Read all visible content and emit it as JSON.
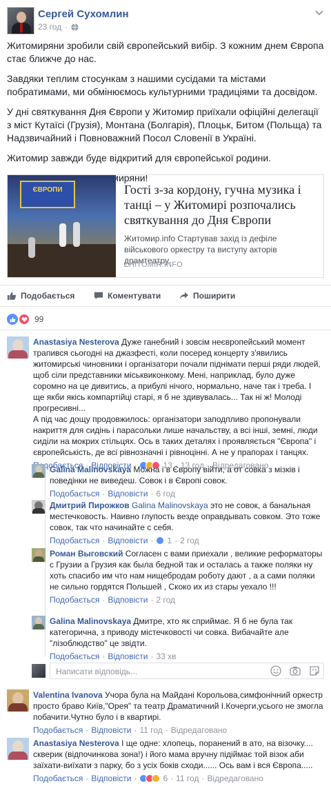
{
  "post": {
    "author": "Сергей Сухомлин",
    "time": "23 год",
    "paragraphs": [
      "Житомиряни зробили свій європейський вибір. З кожним днем Європа стає ближче до нас.",
      "Завдяки теплим стосункам з нашими сусідами та містами побратимами, ми обмінюємось культурними традиціями та досвідом.",
      "У дні святкування Дня Європи у Житомир приїхали офіційні делегації з міст Кутаїсі (Грузія), Монтана (Болгарія), Плоцьк, Битом (Польща) та Надзвичайний і Повноважний Посол Словенії в Україні.",
      "Житомир завжди буде відкритий для європейської родини.",
      "Зі святом Європи, житомиряни!"
    ]
  },
  "link": {
    "image_banner": "ЄВРОПИ",
    "title": "Гості з-за кордону, гучна музика і танці – у Житомирі розпочались святкування до Дня Європи",
    "description": "Житомир.info Стартував захід із дефіле військового оркестру та виступу акторів драмтеатру.",
    "domain": "ZHITOMIR.INFO"
  },
  "actions": {
    "like": "Подобається",
    "comment": "Коментувати",
    "share": "Поширити"
  },
  "reactions": {
    "count": "99"
  },
  "comments": [
    {
      "name": "Anastasiya Nesterova",
      "text": " Дуже ганебний і зовсім неєвропейський момент трапився сьогодні на джазфесті, коли посеред концерту з'явились житомирські чиновники і організатори почали піднімати перші ряди людей, щоб сіли представники міськвиконкому. Мені, наприклад, було дуже соромно на це дивитись, а прибулі нічого, нормально, наче так і треба. І ще якби якісь компартійці старі, я б не здивувалась... Так ні ж! Молоді прогресивні...",
      "text2": "А під час дощу продовжилось: організатори заподпливо пропонували накриття для сидінь і парасольки лише начальству, а всі інші, земні, люди сиділи на мокрих стільцях. Ось в таких деталях і проявляється \"Європа\" і європейськість, де всі рівнозначні і рівноцінні. А не у прапорах і танцях.",
      "like": "Подобається",
      "reply": "Відповісти",
      "react_count": "13",
      "time": "13 год",
      "edited": "Відредаговано"
    },
    {
      "name": "Galina Malinovskaya",
      "text": " Можна і в Європу війти, а от совка з мізків і поведінки не виведеш. Совок і в Європі совок.",
      "like": "Подобається",
      "reply": "Відповісти",
      "time": "6 год"
    },
    {
      "name": "Дмитрий Пирожков",
      "mention": " Galina Malinovskaya",
      "text": " это не совок, а банальная местечковость. Наивно глупость везде оправдывать совком. Это тоже совок, так что начинайте с себя.",
      "like": "Подобається",
      "reply": "Відповісти",
      "react_count": "1",
      "time": "2 год"
    },
    {
      "name": "Роман Выговский",
      "text": " Согласен с вами приехали , великие реформаторы с Грузии а Грузия как была бедной так и осталась а также поляки ну хоть спасибо им что нам нищебродам роботу дают , а а сами поляки не сильно гордятся Польшей , Скоко их из стары уехало !!!",
      "like": "Подобається",
      "reply": "Відповісти",
      "time": "2 год"
    },
    {
      "name": "Galina Malinovskaya",
      "text": " Дмитре, хто як сприймає. Я б не була так категорична, з приводу містечковості чи совка. Вибачайте але \"лізоблюдство\" це звідти.",
      "like": "Подобається",
      "reply": "Відповісти",
      "time": "33 хв"
    },
    {
      "name": "Valentina Ivanova",
      "text": " Учора була на Майдані Корольова,симфонічний оркестр просто браво Київ,\"Орея\" та театр Драматичний І.Кочерги,усього не змогла побачити.Чутно було і в квартирі.",
      "like": "Подобається",
      "reply": "Відповісти",
      "time": "11 год",
      "edited": "Відредаговано"
    },
    {
      "name": "Anastasiya Nesterova",
      "text": " І ще одне: хлопець, поранений в ато, на візочку.... скверик (відпочинкова зона!) і його мама вручну підіймає той візок аби заїхати-виїхати з парку, бо з усіх боків сходи...... Ось вам і вся Європа.....",
      "like": "Подобається",
      "reply": "Відповісти",
      "react_count": "6",
      "time": "11 год",
      "edited": "Відредаговано"
    }
  ],
  "reply_box": {
    "placeholder": "Написати відповідь..."
  },
  "colors": {
    "link_blue": "#365899",
    "meta_gray": "#90949c",
    "like_blue": "#5890ff",
    "love_red": "#f25268"
  }
}
